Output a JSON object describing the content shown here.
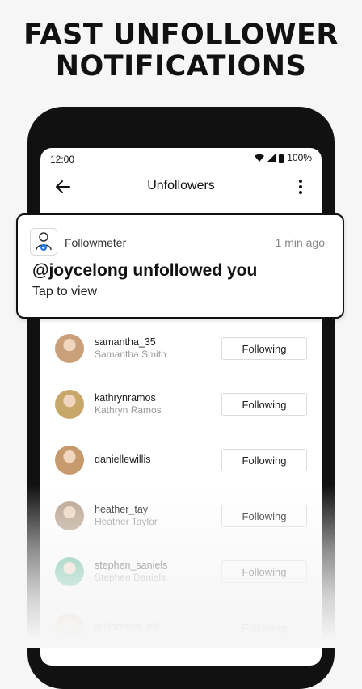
{
  "headline": {
    "line1": "FAST UNFOLLOWER",
    "line2": "NOTIFICATIONS"
  },
  "status_bar": {
    "time": "12:00",
    "battery": "100%"
  },
  "app_bar": {
    "title": "Unfollowers"
  },
  "notification": {
    "app_name": "Followmeter",
    "time_ago": "1 min ago",
    "message": "@joycelong unfollowed you",
    "action": "Tap to view"
  },
  "users": [
    {
      "username": "samantha_35",
      "name": "Samantha Smith",
      "button": "Following",
      "avatar_color": "#c9a07a"
    },
    {
      "username": "kathrynramos",
      "name": "Kathryn Ramos",
      "button": "Following",
      "avatar_color": "#c8a86a"
    },
    {
      "username": "daniellewillis",
      "name": "",
      "button": "Following",
      "avatar_color": "#c79a6e"
    },
    {
      "username": "heather_tay",
      "name": "Heather Taylor",
      "button": "Following",
      "avatar_color": "#b8a38e"
    },
    {
      "username": "stephen_saniels",
      "name": "Stephen Daniels",
      "button": "Following",
      "avatar_color": "#4bb58f"
    },
    {
      "username": "williamson_mil",
      "name": "",
      "button": "Following",
      "avatar_color": "#c9b39a"
    }
  ],
  "colors": {
    "frame": "#111111",
    "background": "#f6f6f6",
    "accent": "#1a73e8"
  }
}
